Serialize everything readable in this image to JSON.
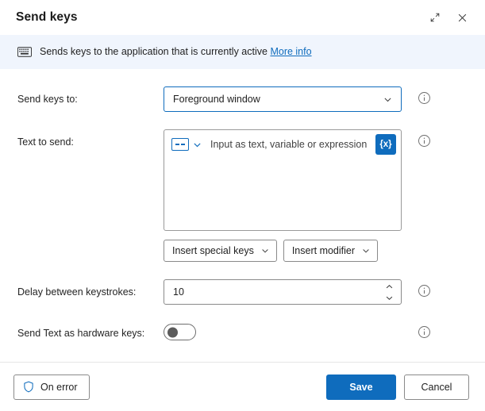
{
  "window": {
    "title": "Send keys",
    "expand_icon": "expand-diagonal-icon",
    "close_icon": "close-icon"
  },
  "banner": {
    "icon": "keyboard-icon",
    "text": "Sends keys to the application that is currently active",
    "link_label": "More info"
  },
  "fields": {
    "send_keys_to": {
      "label": "Send keys to:",
      "value": "Foreground window",
      "info_icon": "info-circle-icon",
      "chevron_icon": "chevron-down-icon"
    },
    "text_to_send": {
      "label": "Text to send:",
      "placeholder": "Input as text, variable or expression",
      "value": "",
      "type_icon": "text-input-type-icon",
      "chevron_icon": "chevron-down-icon",
      "variable_button_label": "{x}",
      "info_icon": "info-circle-icon",
      "insert_special_keys_label": "Insert special keys",
      "insert_modifier_label": "Insert modifier"
    },
    "delay_between_keystrokes": {
      "label": "Delay between keystrokes:",
      "value": "10",
      "info_icon": "info-circle-icon",
      "spinner_up_icon": "chevron-up-icon",
      "spinner_down_icon": "chevron-down-icon"
    },
    "send_text_as_hardware_keys": {
      "label": "Send Text as hardware keys:",
      "state": "off",
      "info_icon": "info-circle-icon"
    }
  },
  "footer": {
    "on_error_label": "On error",
    "on_error_icon": "shield-icon",
    "save_label": "Save",
    "cancel_label": "Cancel"
  },
  "colors": {
    "accent": "#0f6cbd",
    "banner_bg": "#f0f5fd",
    "border": "#8a8a8a",
    "text": "#1f1f1f"
  }
}
